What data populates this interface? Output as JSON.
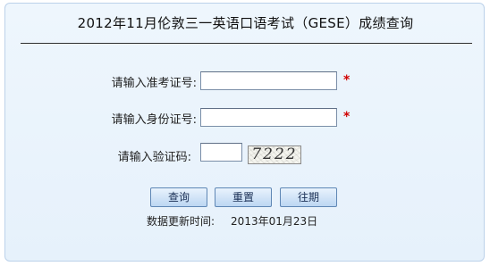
{
  "page": {
    "title": "2012年11月伦敦三一英语口语考试（GESE）成绩查询"
  },
  "form": {
    "ticket_label": "请输入准考证号:",
    "ticket_value": "",
    "id_label": "请输入身份证号:",
    "id_value": "",
    "captcha_label": "请输入验证码:",
    "captcha_value": "",
    "captcha_image_text": "7222",
    "required_mark": "*"
  },
  "buttons": {
    "query_label": "查询",
    "reset_label": "重置",
    "past_label": "往期"
  },
  "footer": {
    "update_label": "数据更新时间:",
    "update_value": "2013年01月23日"
  },
  "colors": {
    "required": "#d00000",
    "button_border": "#5f87b5",
    "panel_border": "#bcd2ea"
  }
}
